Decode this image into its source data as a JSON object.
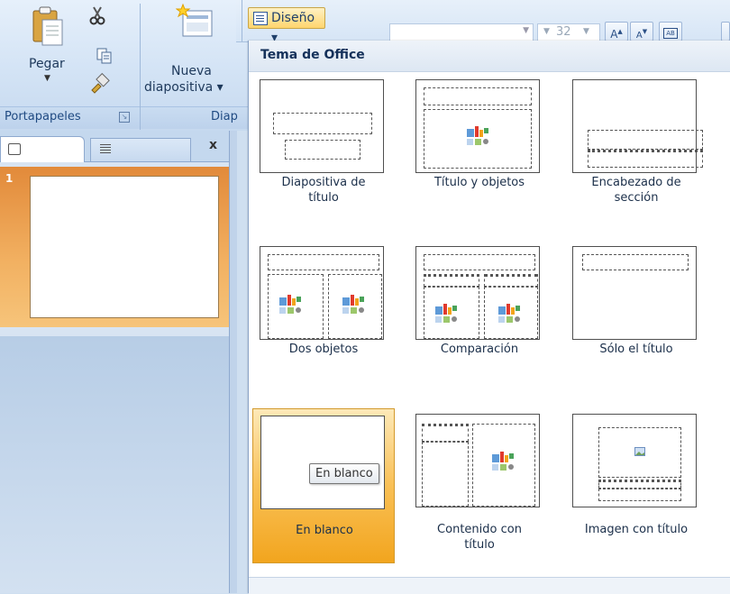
{
  "ribbon": {
    "paste_label": "Pegar",
    "new_slide_line1": "Nueva",
    "new_slide_line2": "diapositiva ▾",
    "group_clipboard": "Portapapeles",
    "group_slides": "Diap",
    "layout_button": "Diseño ▾",
    "font_size": "32"
  },
  "slides_pane": {
    "close": "x",
    "slide_number": "1"
  },
  "gallery": {
    "title": "Tema de Office",
    "tooltip": "En blanco",
    "layouts": [
      {
        "line1": "Diapositiva de",
        "line2": "título"
      },
      {
        "line1": "Título y objetos",
        "line2": ""
      },
      {
        "line1": "Encabezado de",
        "line2": "sección"
      },
      {
        "line1": "Dos objetos",
        "line2": ""
      },
      {
        "line1": "Comparación",
        "line2": ""
      },
      {
        "line1": "Sólo el título",
        "line2": ""
      },
      {
        "line1": "En blanco",
        "line2": ""
      },
      {
        "line1": "Contenido con",
        "line2": "título"
      },
      {
        "line1": "Imagen con título",
        "line2": ""
      }
    ],
    "selected_index": 6
  },
  "icons": [
    "paste-icon",
    "cut-icon",
    "copy-icon",
    "format-painter-icon",
    "new-slide-icon",
    "layout-icon",
    "grow-font-icon",
    "shrink-font-icon",
    "clear-format-icon",
    "slide-tab-icon",
    "outline-tab-icon",
    "insert-object-icon",
    "picture-icon"
  ]
}
